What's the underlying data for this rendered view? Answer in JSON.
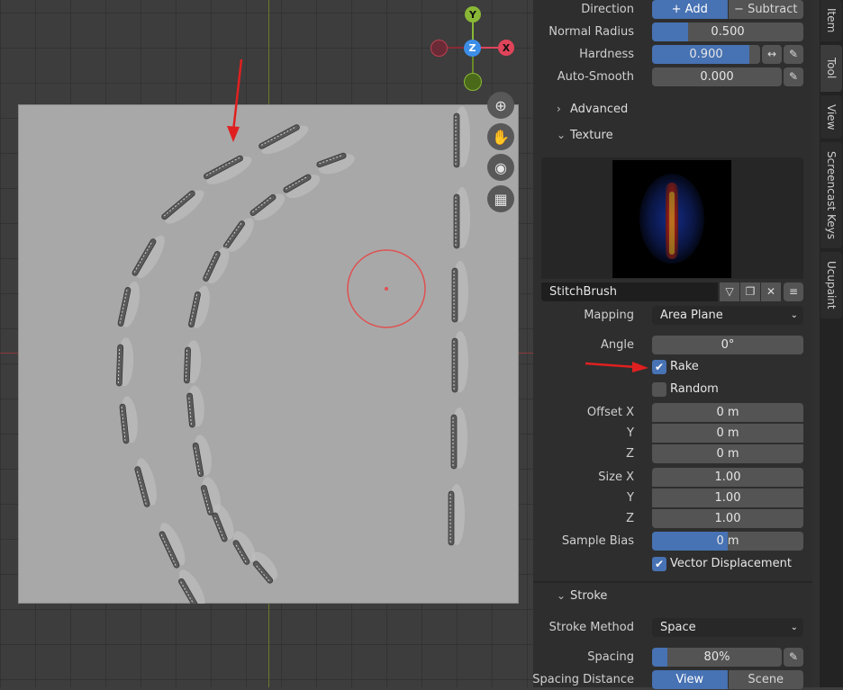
{
  "panel": {
    "direction": {
      "label": "Direction",
      "add": "Add",
      "subtract": "Subtract"
    },
    "normal_radius": {
      "label": "Normal Radius",
      "value": "0.500",
      "fraction": 0.24
    },
    "hardness": {
      "label": "Hardness",
      "value": "0.900",
      "fraction": 0.9
    },
    "auto_smooth": {
      "label": "Auto-Smooth",
      "value": "0.000"
    },
    "advanced": {
      "title": "Advanced",
      "expanded": false
    },
    "texture": {
      "title": "Texture",
      "name": "StitchBrush",
      "mapping": {
        "label": "Mapping",
        "value": "Area Plane"
      },
      "angle": {
        "label": "Angle",
        "value": "0°"
      },
      "rake": {
        "label": "Rake",
        "checked": true
      },
      "random": {
        "label": "Random",
        "checked": false
      },
      "offset": {
        "label": "Offset X",
        "y_label": "Y",
        "z_label": "Z",
        "x": "0 m",
        "y": "0 m",
        "z": "0 m"
      },
      "size": {
        "label": "Size X",
        "y_label": "Y",
        "z_label": "Z",
        "x": "1.00",
        "y": "1.00",
        "z": "1.00"
      },
      "sample_bias": {
        "label": "Sample Bias",
        "value": "0 m"
      },
      "vector_displacement": {
        "label": "Vector Displacement",
        "checked": true
      }
    },
    "stroke": {
      "title": "Stroke",
      "method": {
        "label": "Stroke Method",
        "value": "Space"
      },
      "spacing": {
        "label": "Spacing",
        "value": "80%",
        "fraction": 0.12
      },
      "spacing_distance": {
        "label": "Spacing Distance",
        "view": "View",
        "scene": "Scene"
      }
    }
  },
  "tabs": [
    "Item",
    "Tool",
    "View",
    "Screencast Keys",
    "Ucupaint"
  ],
  "gizmo": {
    "y": "Y",
    "z": "Z",
    "x": "X"
  },
  "colors": {
    "accent": "#4772b3",
    "annotation_arrow": "#e02020",
    "brush_cursor": "#e05050"
  }
}
